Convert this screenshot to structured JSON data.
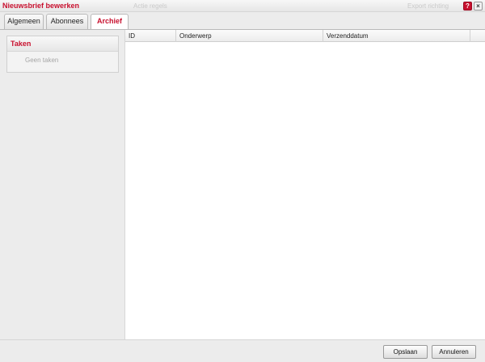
{
  "window": {
    "title": "Nieuwsbrief bewerken",
    "help_label": "?",
    "close_label": "×",
    "ghost_text_1": "Actie regels",
    "ghost_text_2": "Export richting"
  },
  "tabs": [
    {
      "label": "Algemeen",
      "active": false
    },
    {
      "label": "Abonnees",
      "active": false
    },
    {
      "label": "Archief",
      "active": true
    }
  ],
  "sidebar": {
    "tasks_title": "Taken",
    "tasks_empty": "Geen taken"
  },
  "grid": {
    "columns": [
      "ID",
      "Onderwerp",
      "Verzenddatum",
      ""
    ],
    "rows": []
  },
  "footer": {
    "save_label": "Opslaan",
    "cancel_label": "Annuleren"
  },
  "colors": {
    "accent": "#c8102e",
    "background": "#ececec",
    "grid_background": "#ffffff"
  }
}
